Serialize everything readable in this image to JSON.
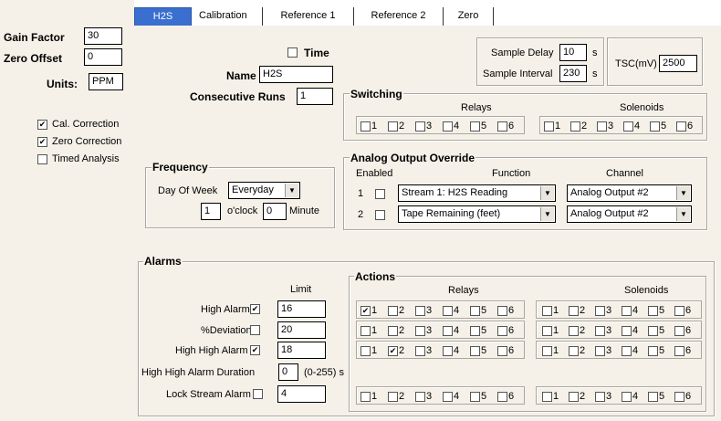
{
  "left": {
    "gain_factor_label": "Gain Factor",
    "gain_factor_value": "30",
    "zero_offset_label": "Zero Offset",
    "zero_offset_value": "0",
    "units_label": "Units:",
    "units_value": "PPM",
    "checks": [
      {
        "label": "Cal. Correction",
        "checked": true
      },
      {
        "label": "Zero Correction",
        "checked": true
      },
      {
        "label": "Timed Analysis",
        "checked": false
      }
    ]
  },
  "tabs": [
    "H2S",
    "Calibration",
    "Reference 1",
    "Reference 2",
    "Zero"
  ],
  "general": {
    "time_label": "Time",
    "name_label": "Name",
    "name_value": "H2S",
    "consecutive_runs_label": "Consecutive Runs",
    "consecutive_runs_value": "1",
    "sample_delay_label": "Sample Delay",
    "sample_delay_value": "10",
    "sample_interval_label": "Sample Interval",
    "sample_interval_value": "230",
    "seconds_unit": "s",
    "tsc_label": "TSC(mV)",
    "tsc_value": "2500"
  },
  "switching": {
    "title": "Switching",
    "relays_label": "Relays",
    "solenoids_label": "Solenoids",
    "numbers": [
      "1",
      "2",
      "3",
      "4",
      "5",
      "6"
    ]
  },
  "frequency": {
    "title": "Frequency",
    "day_of_week_label": "Day Of Week",
    "day_of_week_value": "Everyday",
    "hour_value": "1",
    "oclock_label": "o'clock",
    "minute_value": "0",
    "minute_label": "Minute"
  },
  "analog": {
    "title": "Analog Output Override",
    "enabled_label": "Enabled",
    "function_label": "Function",
    "channel_label": "Channel",
    "rows": [
      {
        "num": "1",
        "function": "Stream 1: H2S Reading",
        "channel": "Analog Output #2"
      },
      {
        "num": "2",
        "function": "Tape Remaining (feet)",
        "channel": "Analog Output #2"
      }
    ]
  },
  "alarms": {
    "title": "Alarms",
    "limit_label": "Limit",
    "high_alarm_label": "High Alarm",
    "high_alarm_value": "16",
    "deviation_label": "%Deviation",
    "deviation_value": "20",
    "high_high_label": "High High Alarm",
    "high_high_value": "18",
    "hh_duration_label": "High High Alarm Duration",
    "hh_duration_value": "0",
    "hh_duration_range": "(0-255) s",
    "lock_stream_label": "Lock Stream Alarm",
    "lock_stream_value": "4"
  },
  "actions": {
    "title": "Actions",
    "relays_label": "Relays",
    "solenoids_label": "Solenoids",
    "numbers": [
      "1",
      "2",
      "3",
      "4",
      "5",
      "6"
    ]
  }
}
